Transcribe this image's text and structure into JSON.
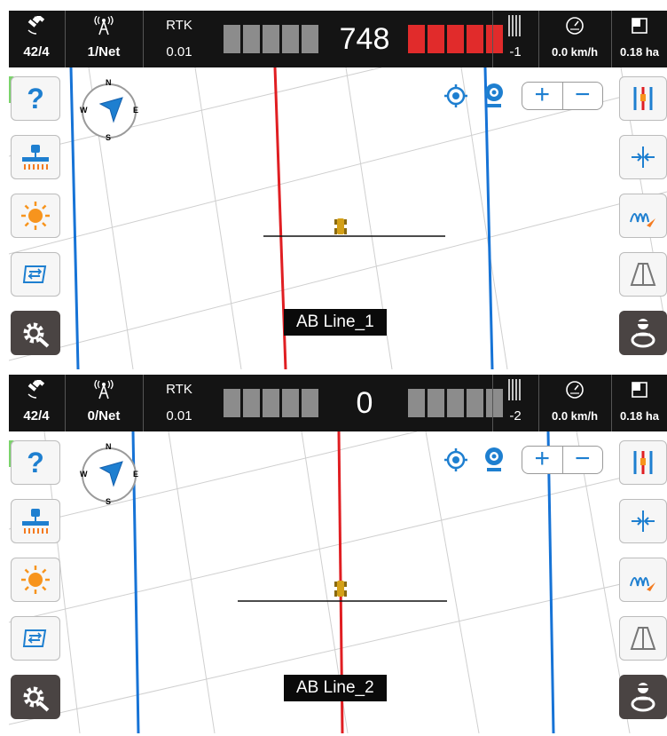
{
  "panels": [
    {
      "status": {
        "satellites": "42/4",
        "network": "1/Net",
        "rtk_label": "RTK",
        "rtk_value": "0.01",
        "deviation": "748",
        "left_segments": "gray",
        "right_segments": "red",
        "line_offset": "-1",
        "speed": "0.0 km/h",
        "area": "0.18 ha"
      },
      "ab_line_label": "AB Line_1"
    },
    {
      "status": {
        "satellites": "42/4",
        "network": "0/Net",
        "rtk_label": "RTK",
        "rtk_value": "0.01",
        "deviation": "0",
        "left_segments": "gray",
        "right_segments": "gray",
        "line_offset": "-2",
        "speed": "0.0 km/h",
        "area": "0.18 ha"
      },
      "ab_line_label": "AB Line_2"
    }
  ],
  "compass": {
    "n": "N",
    "s": "S",
    "e": "E",
    "w": "W"
  },
  "zoom": {
    "in": "+",
    "out": "−"
  },
  "colors": {
    "guide_line": "#e01e22",
    "boundary_line": "#1673d6",
    "accent": "#1e7fd0",
    "deviation_bad": "#e12b2b",
    "deviation_ok": "#8c8c8c"
  },
  "left_toolbar": [
    "help-icon",
    "implement-icon",
    "brightness-icon",
    "field-switch-icon",
    "settings-icon"
  ],
  "right_toolbar": [
    "guidance-lines-icon",
    "offset-adjust-icon",
    "curve-mode-icon",
    "road-view-icon",
    "autosteer-driver-icon"
  ]
}
